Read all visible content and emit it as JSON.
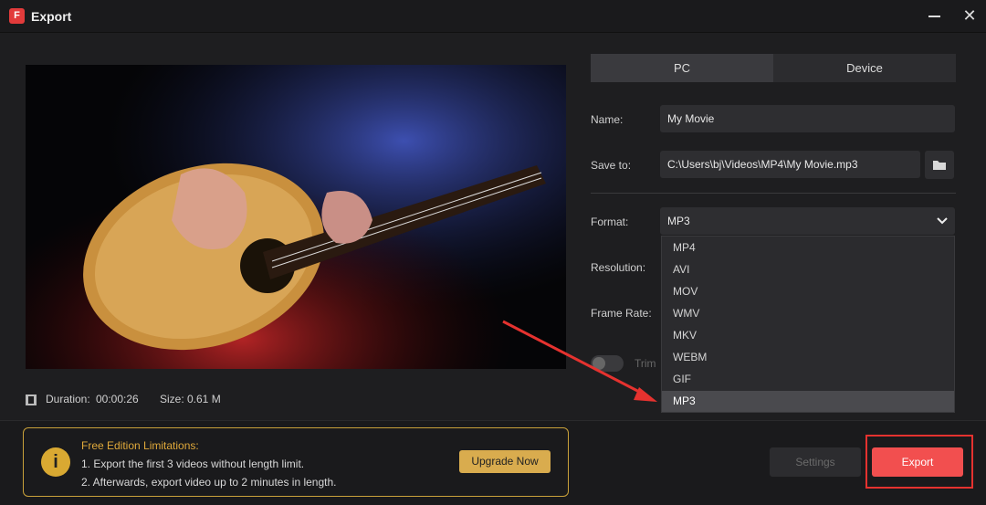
{
  "window": {
    "title": "Export",
    "app_icon": "app-logo-icon"
  },
  "preview": {
    "description_icon": "film-icon",
    "duration_label": "Duration:",
    "duration_value": "00:00:26",
    "size_label": "Size:",
    "size_value": "0.61 M"
  },
  "tabs": [
    {
      "label": "PC",
      "active": true
    },
    {
      "label": "Device",
      "active": false
    }
  ],
  "form": {
    "name_label": "Name:",
    "name_value": "My Movie",
    "save_label": "Save to:",
    "save_value": "C:\\Users\\bj\\Videos\\MP4\\My Movie.mp3",
    "format_label": "Format:",
    "format_value": "MP3",
    "resolution_label": "Resolution:",
    "framerate_label": "Frame Rate:",
    "trim_label": "Trim"
  },
  "format_options": [
    "MP4",
    "AVI",
    "MOV",
    "WMV",
    "MKV",
    "WEBM",
    "GIF",
    "MP3"
  ],
  "format_selected": "MP3",
  "limits": {
    "title": "Free Edition Limitations:",
    "line1": "1. Export the first 3 videos without length limit.",
    "line2": "2. Afterwards, export video up to 2 minutes in length.",
    "upgrade_label": "Upgrade Now"
  },
  "buttons": {
    "settings_label": "Settings",
    "export_label": "Export"
  },
  "colors": {
    "accent_red": "#f24f4f",
    "gold": "#d9ac4e",
    "panel": "#2e2e31"
  }
}
